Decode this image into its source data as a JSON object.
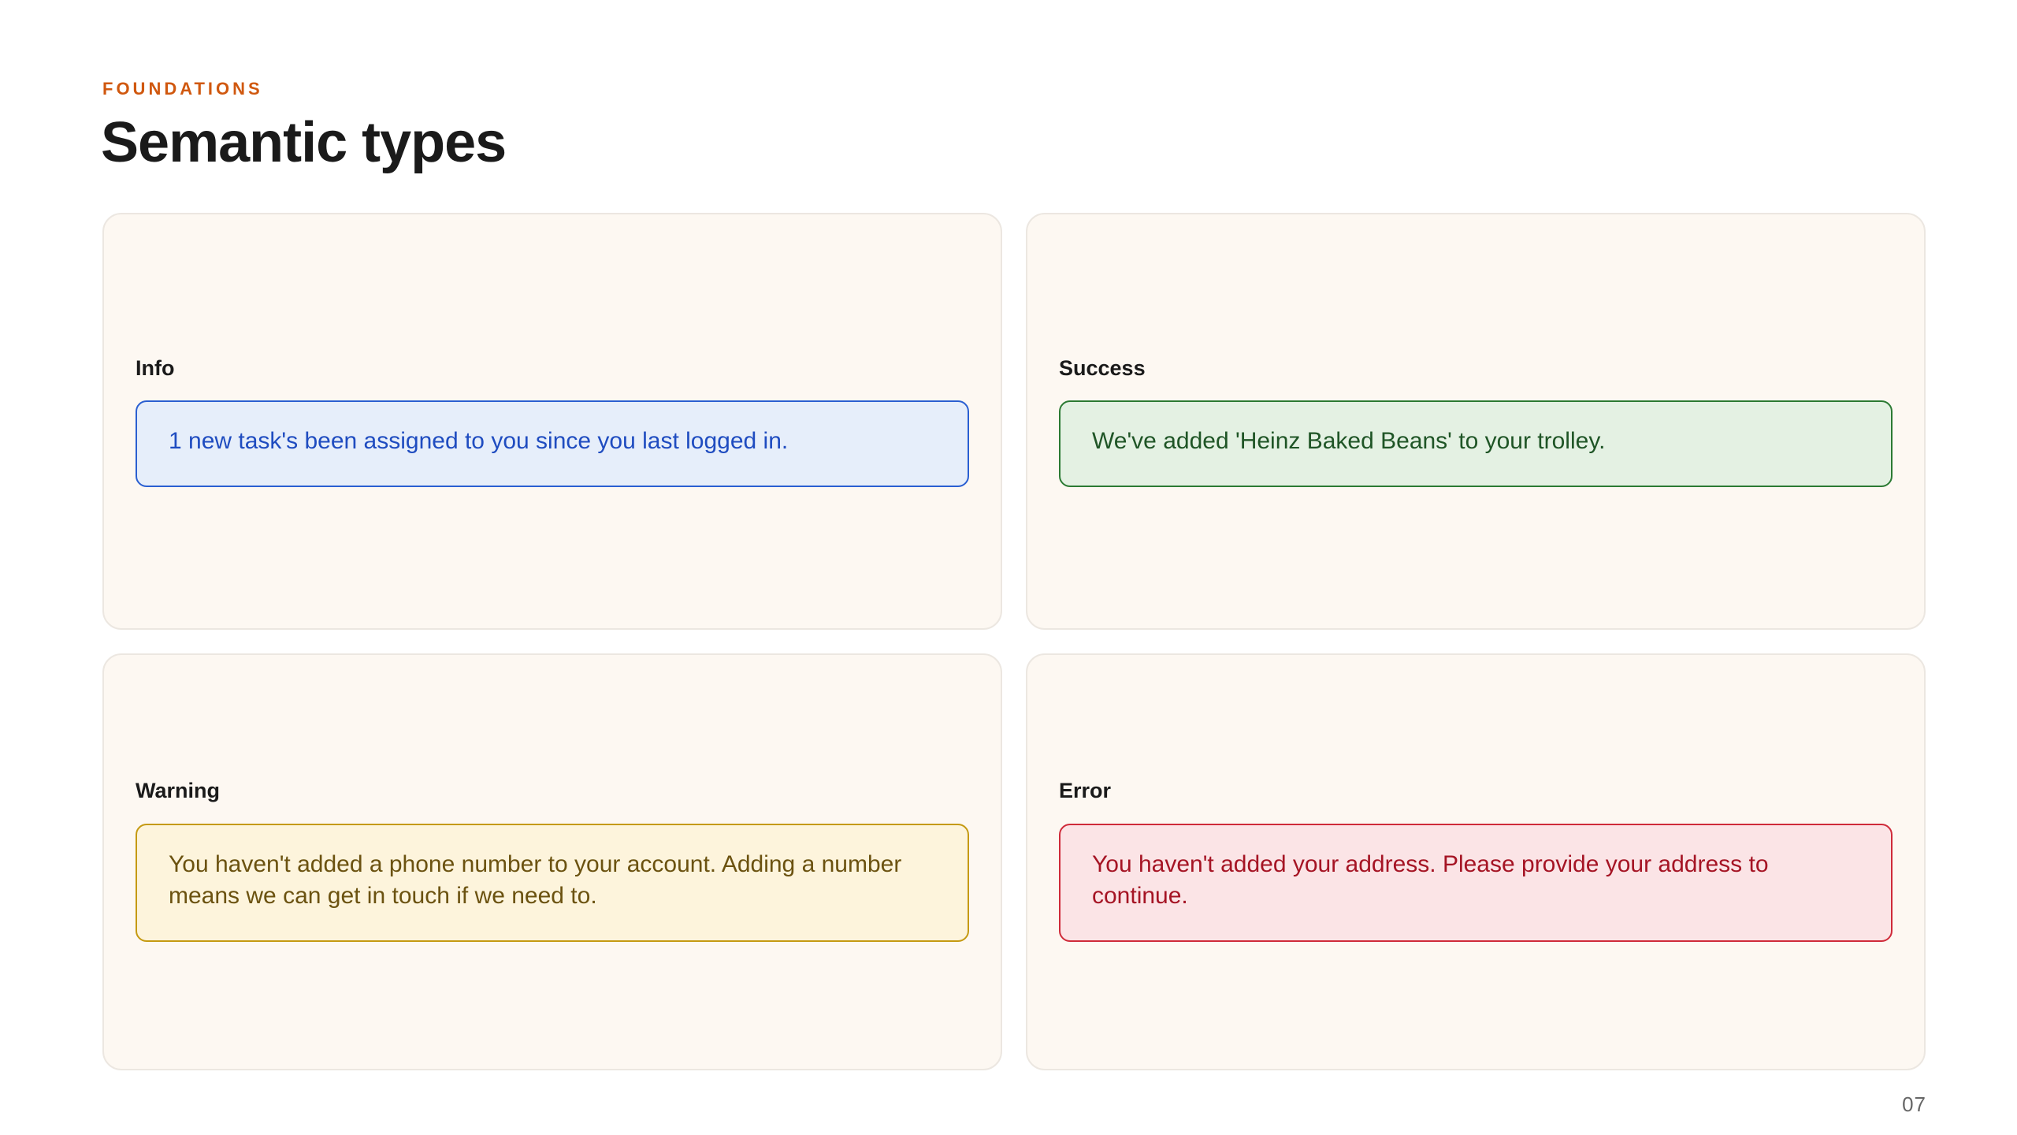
{
  "header": {
    "eyebrow": "FOUNDATIONS",
    "title": "Semantic types"
  },
  "colors": {
    "eyebrow": "#d0580f",
    "info": "#2a5fd1",
    "success": "#2b7a33",
    "warning": "#c59a12",
    "error": "#cf2b3a",
    "card_background": "#fdf8f2"
  },
  "cards": [
    {
      "label": "Info",
      "message": "1 new task's been assigned to you since you last logged in."
    },
    {
      "label": "Success",
      "message": "We've added 'Heinz Baked Beans' to your trolley."
    },
    {
      "label": "Warning",
      "message": "You haven't added a phone number to your account. Adding a number means we can get in touch if we need to."
    },
    {
      "label": "Error",
      "message": "You haven't added your address. Please provide your address to continue."
    }
  ],
  "footer": {
    "page_number": "07"
  }
}
